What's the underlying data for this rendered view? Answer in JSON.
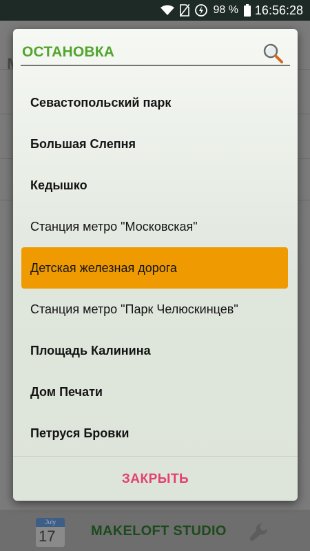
{
  "status_bar": {
    "battery_percent": "98 %",
    "time": "16:56:28",
    "icons": [
      "wifi-icon",
      "no-sim-icon",
      "battery-saver-icon",
      "battery-icon"
    ]
  },
  "background_app": {
    "calendar_month": "July",
    "calendar_day": "17",
    "brand": "MAKELOFT STUDIO",
    "icons": [
      "calendar-icon",
      "wrench-icon"
    ]
  },
  "dialog": {
    "title": "ОСТАНОВКА",
    "search_icon": "search-icon",
    "items": [
      {
        "label": "Севастопольский парк",
        "selected": false
      },
      {
        "label": "Большая Слепня",
        "selected": false
      },
      {
        "label": "Кедышко",
        "selected": false
      },
      {
        "label": "Станция метро \"Московская\"",
        "selected": false
      },
      {
        "label": "Детская железная дорога",
        "selected": true
      },
      {
        "label": "Станция метро \"Парк Челюскинцев\"",
        "selected": false
      },
      {
        "label": "Площадь Калинина",
        "selected": false
      },
      {
        "label": "Дом Печати",
        "selected": false
      },
      {
        "label": "Петруся Бровки",
        "selected": false
      }
    ],
    "close_label": "ЗАКРЫТЬ"
  },
  "colors": {
    "title": "#52a52d",
    "selected_item": "#ee9a00",
    "close": "#e3406e"
  }
}
